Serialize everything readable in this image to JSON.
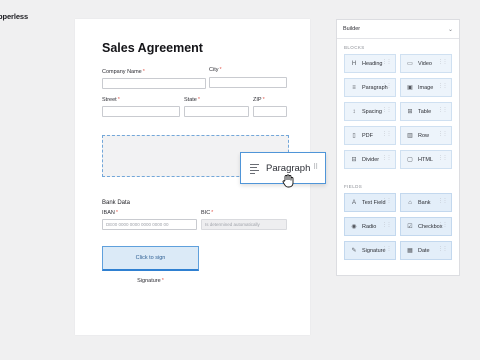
{
  "brand": "pperless",
  "document": {
    "title": "Sales Agreement",
    "company_label": "Company Name",
    "city_label": "City",
    "street_label": "Street",
    "state_label": "State",
    "zip_label": "ZIP",
    "required_mark": "*",
    "bank_section": "Bank Data",
    "iban_label": "IBAN",
    "iban_placeholder": "DE00 0000 0000 0000 0000 00",
    "bic_label": "BIC",
    "bic_placeholder": "Is determined automatically",
    "sign_button": "Click to sign",
    "signature_label": "Signature"
  },
  "drag_preview": {
    "label": "Paragraph"
  },
  "builder": {
    "title": "Builder",
    "blocks_heading": "BLOCKS",
    "fields_heading": "FIELDS",
    "blocks": [
      {
        "label": "Heading",
        "icon": "heading-icon",
        "glyph": "H"
      },
      {
        "label": "Video",
        "icon": "video-icon",
        "glyph": "▭"
      },
      {
        "label": "Paragraph",
        "icon": "paragraph-icon",
        "glyph": "≡"
      },
      {
        "label": "Image",
        "icon": "image-icon",
        "glyph": "▣"
      },
      {
        "label": "Spacing",
        "icon": "spacing-icon",
        "glyph": "↕"
      },
      {
        "label": "Table",
        "icon": "table-icon",
        "glyph": "⊞"
      },
      {
        "label": "PDF",
        "icon": "pdf-icon",
        "glyph": "▯"
      },
      {
        "label": "Row",
        "icon": "row-icon",
        "glyph": "▥"
      },
      {
        "label": "Divider",
        "icon": "divider-icon",
        "glyph": "⊟"
      },
      {
        "label": "HTML",
        "icon": "html-icon",
        "glyph": "▢"
      }
    ],
    "fields": [
      {
        "label": "Text Field",
        "icon": "text-field-icon",
        "glyph": "A"
      },
      {
        "label": "Bank",
        "icon": "bank-icon",
        "glyph": "⌂"
      },
      {
        "label": "Radio",
        "icon": "radio-icon",
        "glyph": "◉"
      },
      {
        "label": "Checkbox",
        "icon": "checkbox-icon",
        "glyph": "☑"
      },
      {
        "label": "Signature",
        "icon": "signature-icon",
        "glyph": "✎"
      },
      {
        "label": "Date",
        "icon": "date-icon",
        "glyph": "▦"
      }
    ]
  },
  "colors": {
    "accent": "#2f80d1",
    "tile_bg": "#edf4fb",
    "required": "#e2594f"
  }
}
